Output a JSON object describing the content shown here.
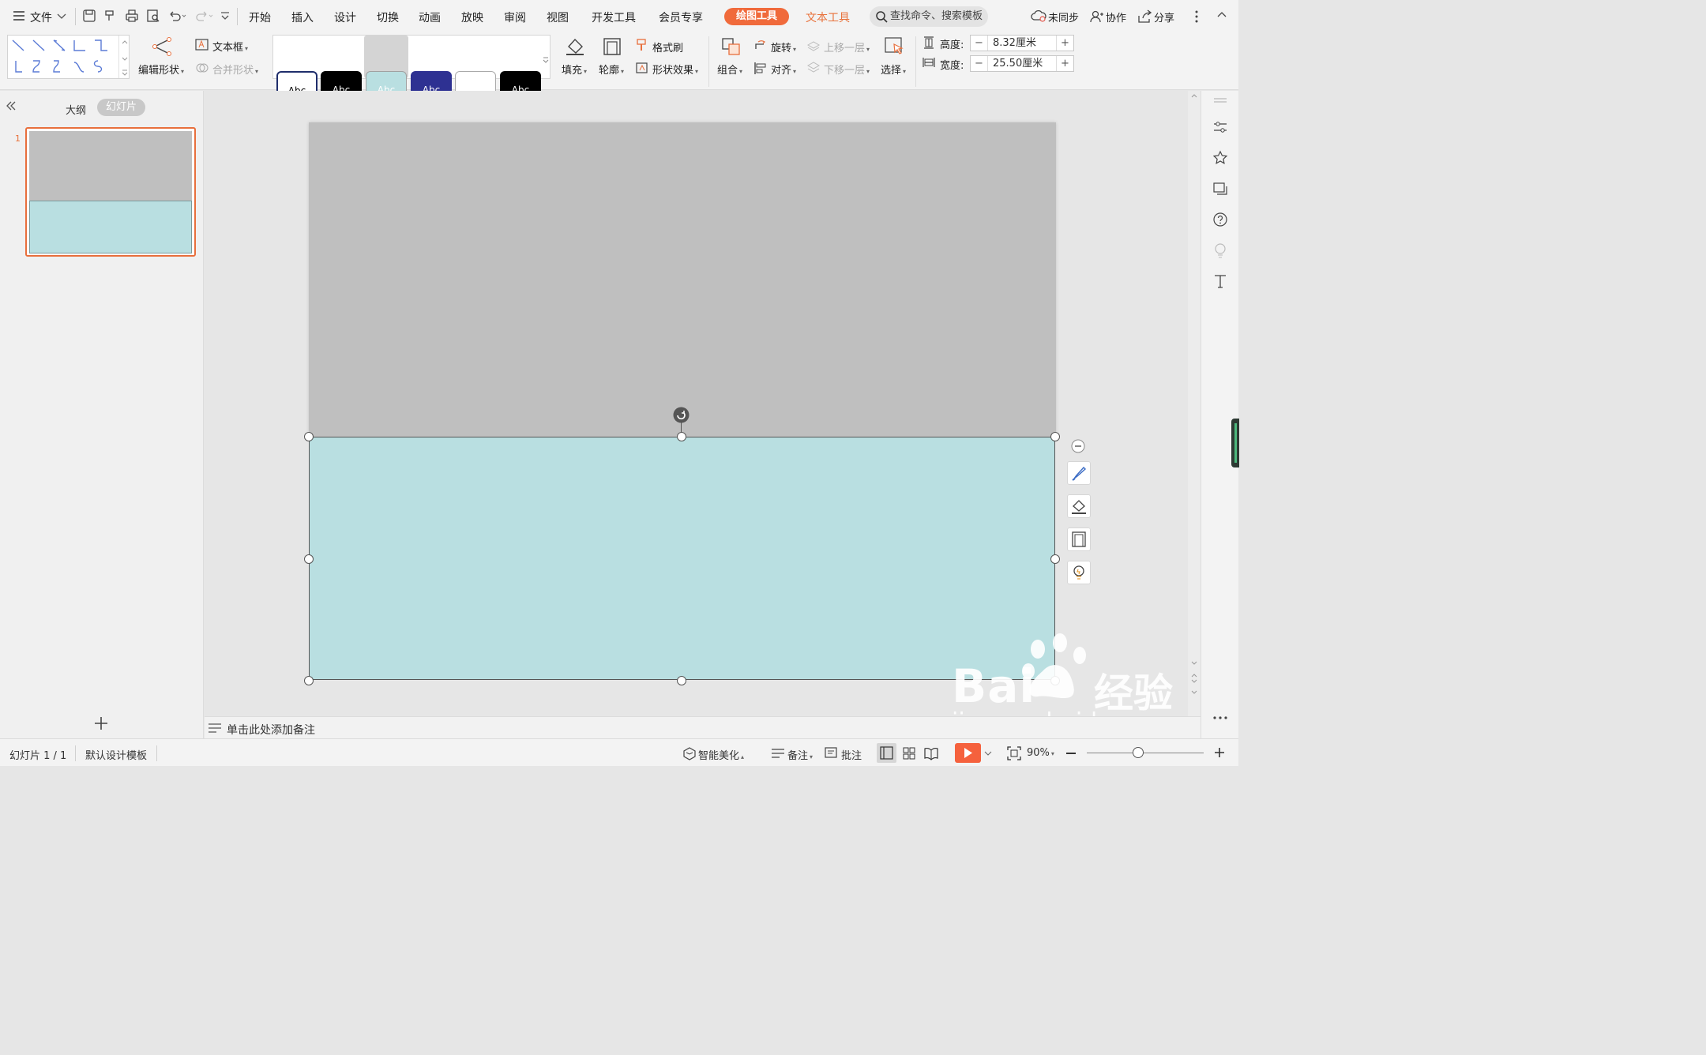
{
  "menubar": {
    "file_label": "文件",
    "tabs": [
      "开始",
      "插入",
      "设计",
      "切换",
      "动画",
      "放映",
      "审阅",
      "视图",
      "开发工具",
      "会员专享"
    ],
    "active_tool_tab": "绘图工具",
    "text_tool_tab": "文本工具",
    "search_placeholder": "查找命令、搜索模板",
    "sync_label": "未同步",
    "collab_label": "协作",
    "share_label": "分享"
  },
  "ribbon": {
    "edit_shape": "编辑形状",
    "textbox": "文本框",
    "merge_shape": "合并形状",
    "style_presets": [
      {
        "label": "Abc",
        "bg": "#ffffff",
        "fg": "#000000",
        "border": "#1f2d6b"
      },
      {
        "label": "Abc",
        "bg": "#000000",
        "fg": "#ffffff",
        "border": "#000000"
      },
      {
        "label": "Abc",
        "bg": "#b9dfe1",
        "fg": "#ffffff",
        "border": "#a0a0a0"
      },
      {
        "label": "Abc",
        "bg": "#2e3192",
        "fg": "#ffffff",
        "border": "#2e3192"
      },
      {
        "label": "",
        "bg": "#ffffff",
        "fg": "#000000",
        "border": "#aaaaaa"
      },
      {
        "label": "Abc",
        "bg": "#000000",
        "fg": "#ffffff",
        "border": "#000000"
      }
    ],
    "fill": "填充",
    "outline": "轮廓",
    "format_painter": "格式刷",
    "shape_effects": "形状效果",
    "group": "组合",
    "rotate": "旋转",
    "align": "对齐",
    "bring_forward": "上移一层",
    "send_backward": "下移一层",
    "select": "选择",
    "height_label": "高度:",
    "height_value": "8.32厘米",
    "width_label": "宽度:",
    "width_value": "25.50厘米"
  },
  "leftpanel": {
    "outline_tab": "大纲",
    "slides_tab": "幻灯片",
    "slide_number": "1"
  },
  "notes_placeholder": "单击此处添加备注",
  "status": {
    "slide_counter": "幻灯片 1 / 1",
    "template": "默认设计模板",
    "beautify": "智能美化",
    "notes": "备注",
    "comments": "批注",
    "zoom": "90%"
  },
  "watermark": {
    "brand": "Bai",
    "brand_cn": "经验",
    "url": "jingyan.baidu.com"
  },
  "colors": {
    "accent": "#f06a3b",
    "shape_fill": "#b9dfe1",
    "slide_bg": "#bfbfbf",
    "play": "#f5613d"
  }
}
